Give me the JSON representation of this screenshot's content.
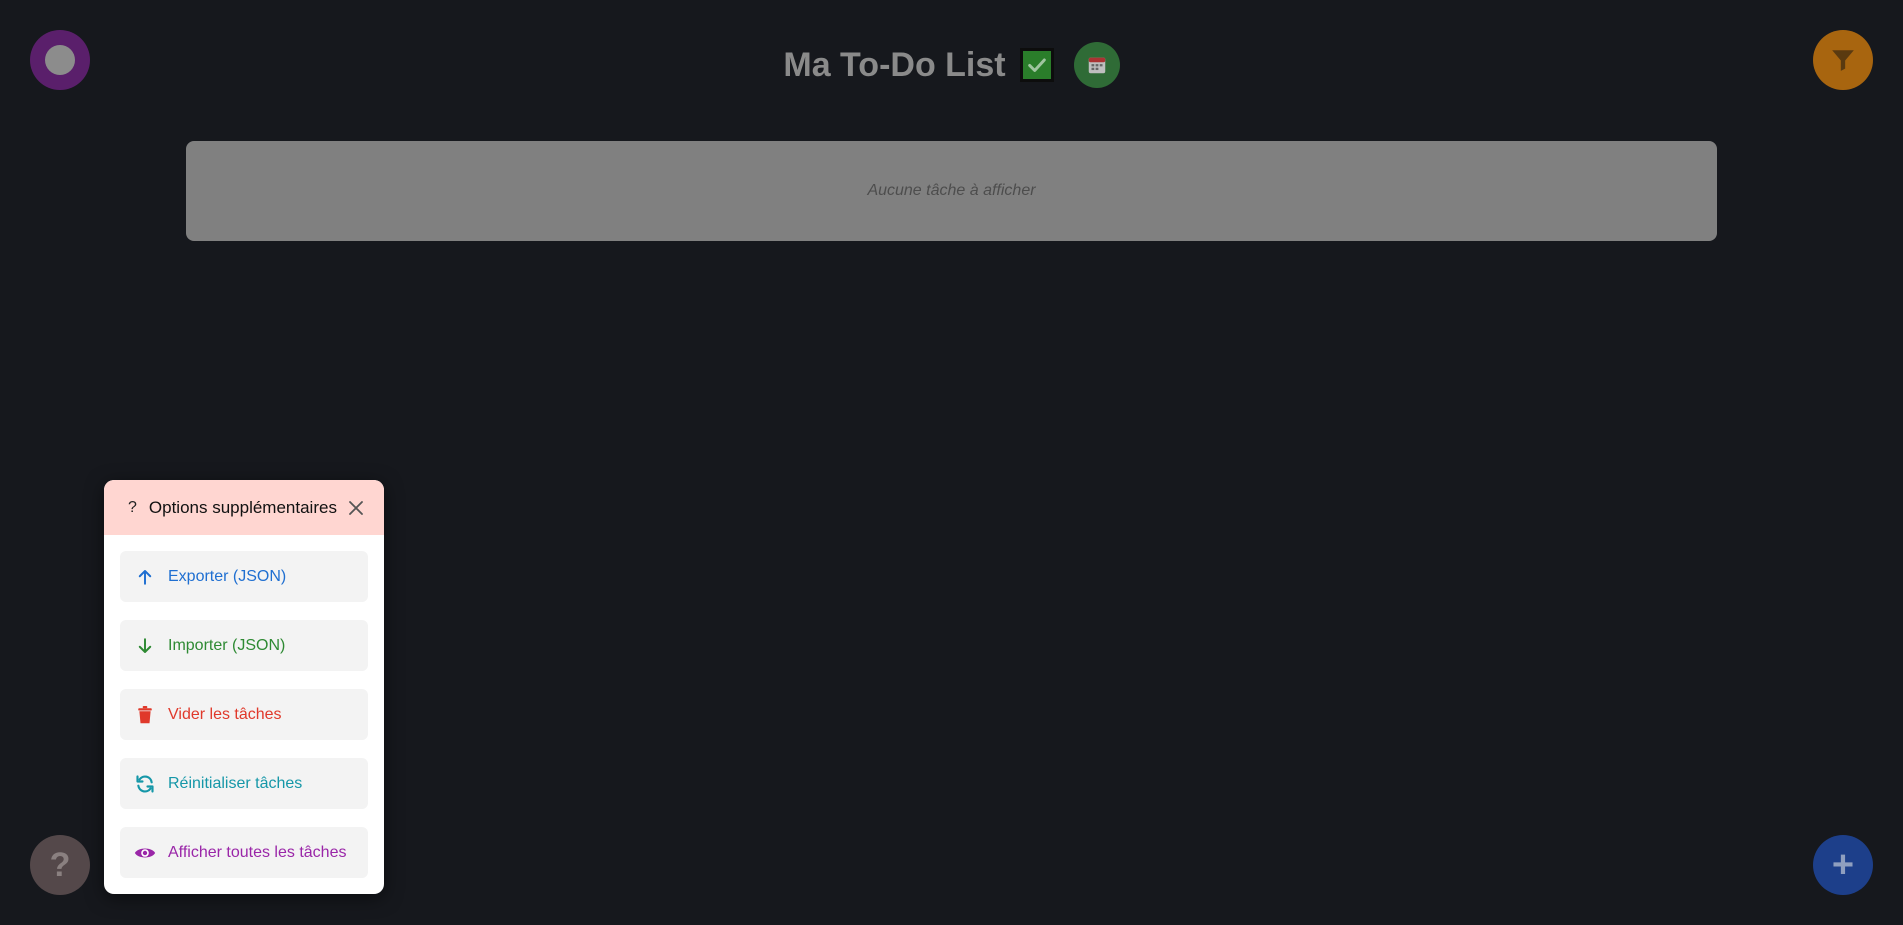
{
  "header": {
    "title": "Ma To-Do List",
    "check_icon": "check-box-icon",
    "calendar_icon": "calendar-icon"
  },
  "tasks": {
    "empty_message": "Aucune tâche à afficher"
  },
  "corner_buttons": {
    "theme_icon": "theme-toggle-icon",
    "filter_icon": "filter-icon",
    "help_glyph": "?",
    "add_glyph": "+"
  },
  "options_popup": {
    "header_icon": "?",
    "title": "Options supplémentaires",
    "close_icon": "close-icon",
    "items": [
      {
        "label": "Exporter (JSON)",
        "icon": "arrow-up-icon",
        "color": "#1f6fd1"
      },
      {
        "label": "Importer (JSON)",
        "icon": "arrow-down-icon",
        "color": "#2e8a33"
      },
      {
        "label": "Vider les tâches",
        "icon": "trash-icon",
        "color": "#e0392b"
      },
      {
        "label": "Réinitialiser tâches",
        "icon": "refresh-icon",
        "color": "#1597a8"
      },
      {
        "label": "Afficher toutes les tâches",
        "icon": "eye-icon",
        "color": "#9a26a8"
      }
    ]
  },
  "colors": {
    "background": "#16181d",
    "title": "#8a8a8a",
    "task_panel": "#808080",
    "popup_header": "#ffd6d1",
    "theme_button": "#5a1f6b",
    "filter_button": "#a8650f",
    "help_button": "#54484a",
    "add_button": "#1d3f8a",
    "calendar_button": "#2f6b36"
  }
}
